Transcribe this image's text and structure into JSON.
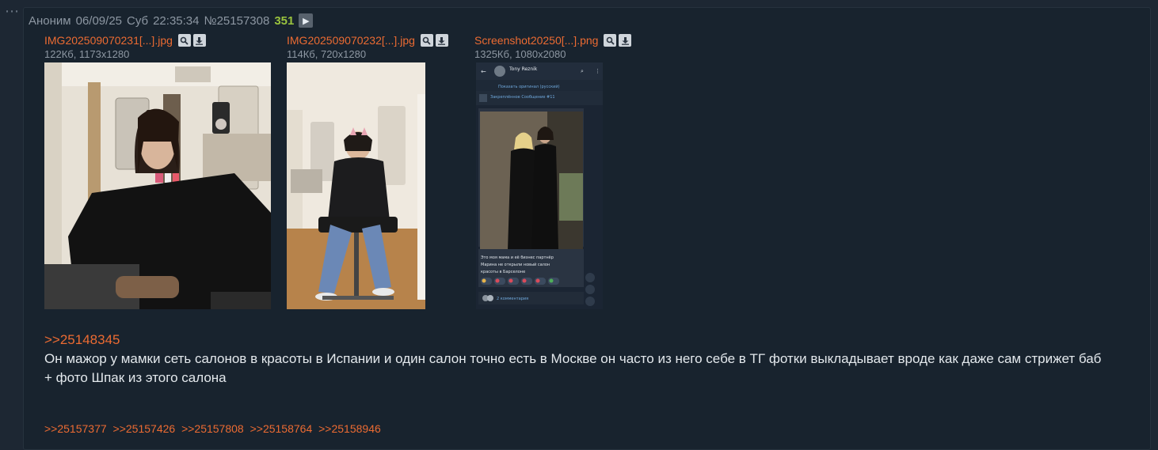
{
  "menu": {
    "icon": "ellipsis-icon",
    "label": "⋯"
  },
  "post": {
    "author": "Аноним",
    "date": "06/09/25",
    "weekday": "Суб",
    "time": "22:35:34",
    "number": "№25157308",
    "reply_count": "351",
    "play_icon": "play-icon",
    "files": [
      {
        "name": "IMG202509070231[...].jpg",
        "meta": "122Кб, 1173x1280"
      },
      {
        "name": "IMG202509070232[...].jpg",
        "meta": "114Кб, 720x1280"
      },
      {
        "name": "Screenshot20250[...].png",
        "meta": "1325Кб, 1080x2080"
      }
    ],
    "screenshot_texts": {
      "channel": "Tony Reznik",
      "translate": "Показать оригинал (русский)",
      "pinned": "Закреплённое Сообщение #11",
      "caption_1": "Это моя мама и её бизнес партнёр",
      "caption_2": "Марина не открыли новый салон",
      "caption_3": "красоты в Барселоне",
      "comments": "2 комментария"
    },
    "quote_link": ">>25148345",
    "text_line_1": "Он мажор у мамки сеть салонов в красоты в Испании и один салон точно есть в Москве он часто из него себе в ТГ фотки выкладывает вроде как даже сам стрижет баб",
    "text_line_2": "+ фото Шпак из этого салона",
    "backlinks": [
      ">>25157377",
      ">>25157426",
      ">>25157808",
      ">>25158764",
      ">>25158946"
    ]
  },
  "colors": {
    "background": "#1d2733",
    "post_bg": "#18232e",
    "link": "#ec6b32",
    "reply_count": "#9ac33e",
    "meta": "#8d97a2",
    "text": "#e3e8ec"
  },
  "icons": [
    "search-icon",
    "download-icon"
  ]
}
